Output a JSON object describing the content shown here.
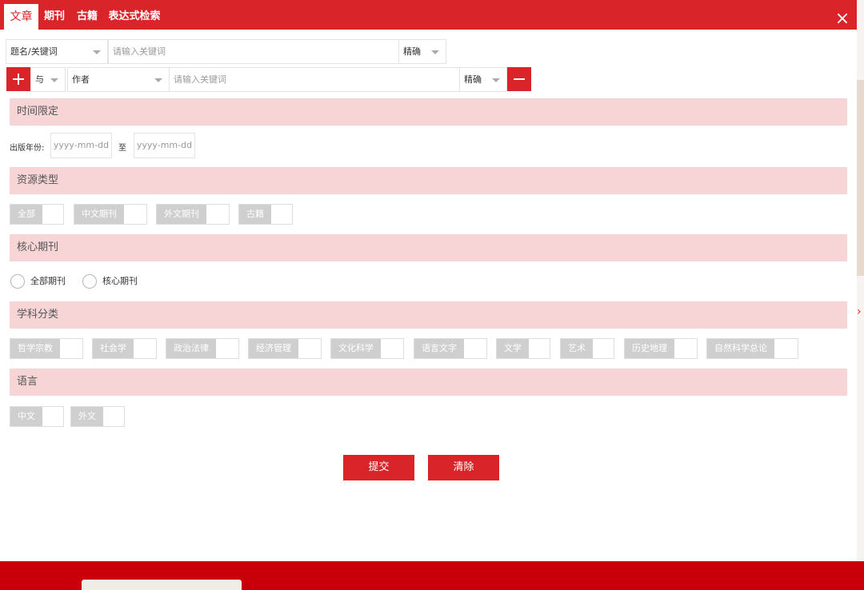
{
  "tabs": [
    {
      "label": "文章",
      "active": true
    },
    {
      "label": "期刊",
      "active": false
    },
    {
      "label": "古籍",
      "active": false
    },
    {
      "label": "表达式检索",
      "active": false
    }
  ],
  "close_icon": "×",
  "row1": {
    "field": "题名/关键词",
    "placeholder": "请输入关键词",
    "match": "精确"
  },
  "row2": {
    "logic": "与",
    "field": "作者",
    "placeholder": "请输入关键词",
    "match": "精确"
  },
  "sections": {
    "time": "时间限定",
    "resource": "资源类型",
    "core": "核心期刊",
    "subject": "学科分类",
    "language": "语言"
  },
  "date": {
    "label": "出版年份:",
    "from_placeholder": "yyyy-mm-dd",
    "sep": "至",
    "to_placeholder": "yyyy-mm-dd"
  },
  "resource_types": [
    "全部",
    "中文期刊",
    "外文期刊",
    "古籍"
  ],
  "core_options": [
    "全部期刊",
    "核心期刊"
  ],
  "subjects": [
    "哲学宗教",
    "社会学",
    "政治法律",
    "经济管理",
    "文化科学",
    "语言文字",
    "文学",
    "艺术",
    "历史地理",
    "自然科学总论"
  ],
  "languages": [
    "中文",
    "外文"
  ],
  "buttons": {
    "submit": "提交",
    "clear": "清除"
  },
  "right_arrow": "›",
  "colors": {
    "accent": "#d9242a",
    "section_bg": "#f7d5d7",
    "toggle_label": "#cfcfcf"
  }
}
